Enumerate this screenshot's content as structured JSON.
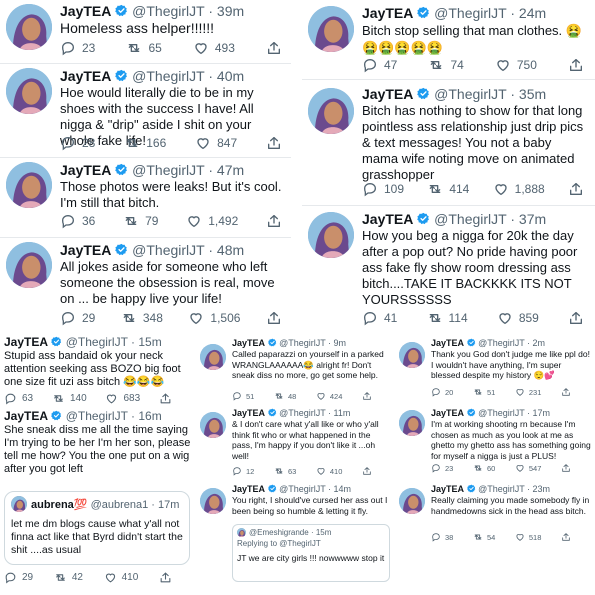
{
  "colors": {
    "text": "#0f1419",
    "secondary": "#536471",
    "verified": "#1d9bf0",
    "border": "#cfd9de"
  },
  "tweets": [
    {
      "name": "JayTEA",
      "handle": "@ThegirlJT",
      "time": "39m",
      "text": "Homeless ass helper!!!!!!",
      "replies": "23",
      "retweets": "65",
      "likes": "493"
    },
    {
      "name": "JayTEA",
      "handle": "@ThegirlJT",
      "time": "24m",
      "text": "Bitch stop selling that man clothes. 🤮\n🤮🤮🤮🤮🤮",
      "replies": "47",
      "retweets": "74",
      "likes": "750"
    },
    {
      "name": "JayTEA",
      "handle": "@ThegirlJT",
      "time": "40m",
      "text": "Hoe would literally die to be in my shoes with the success I have! All nigga & \"drip\" aside I shit on your whole fake life!",
      "replies": "28",
      "retweets": "166",
      "likes": "847"
    },
    {
      "name": "JayTEA",
      "handle": "@ThegirlJT",
      "time": "35m",
      "text": "Bitch has nothing to show for that long pointless ass relationship just drip pics & text messages! You not a baby mama wife noting move on animated grasshopper",
      "replies": "109",
      "retweets": "414",
      "likes": "1,888"
    },
    {
      "name": "JayTEA",
      "handle": "@ThegirlJT",
      "time": "47m",
      "text": "Those photos were leaks! But it's cool. I'm still that bitch.",
      "replies": "36",
      "retweets": "79",
      "likes": "1,492"
    },
    {
      "name": "JayTEA",
      "handle": "@ThegirlJT",
      "time": "37m",
      "text": "How you beg a nigga for 20k the day after a pop out? No pride having poor ass fake fly show room dressing ass bitch....TAKE IT BACKKKK ITS NOT YOURSSSSSS",
      "replies": "41",
      "retweets": "114",
      "likes": "859"
    },
    {
      "name": "JayTEA",
      "handle": "@ThegirlJT",
      "time": "48m",
      "text": "All jokes aside for someone who left someone the obsession is real, move on ... be happy live your life!",
      "replies": "29",
      "retweets": "348",
      "likes": "1,506"
    },
    {
      "name": "JayTEA",
      "handle": "@ThegirlJT",
      "time": "15m",
      "text": "Stupid ass bandaid ok your neck attention seeking ass BOZO big foot one size fit uzi ass bitch 😂😂😂",
      "replies": "63",
      "retweets": "140",
      "likes": "683"
    },
    {
      "name": "JayTEA",
      "handle": "@ThegirlJT",
      "time": "9m",
      "text": "Called paparazzi on yourself in a parked WRANGLAAAAAA😂 alright fr! Don't sneak diss no more, go get some help.",
      "replies": "51",
      "retweets": "48",
      "likes": "424"
    },
    {
      "name": "JayTEA",
      "handle": "@ThegirlJT",
      "time": "2m",
      "text": "Thank you God don't judge me like ppl do! I wouldn't have anything, I'm super blessed despite my history 😌💕",
      "replies": "20",
      "retweets": "51",
      "likes": "231"
    },
    {
      "name": "JayTEA",
      "handle": "@ThegirlJT",
      "time": "16m",
      "text": "She sneak diss me all the time saying I'm trying to be her I'm her son, please tell me how? You the one put on a wig after you got left",
      "quote": {
        "name": "aubrena💯",
        "handle": "@aubrena1",
        "time": "17m",
        "text": "let me dm blogs cause what y'all not finna act like that Byrd didn't start the shit ....as usual"
      },
      "replies": "29",
      "retweets": "42",
      "likes": "410"
    },
    {
      "name": "JayTEA",
      "handle": "@ThegirlJT",
      "time": "11m",
      "text": "& I don't care what y'all like or who y'all think fit who or what happened in the pass, I'm happy if you don't like it ...oh well!",
      "replies": "12",
      "retweets": "63",
      "likes": "410"
    },
    {
      "name": "JayTEA",
      "handle": "@ThegirlJT",
      "time": "17m",
      "text": "I'm at working shooting rn because I'm chosen as much as you look at me as ghetto my ghetto ass has something going for myself a nigga is just a PLUS!",
      "replies": "23",
      "retweets": "60",
      "likes": "547"
    },
    {
      "name": "JayTEA",
      "handle": "@ThegirlJT",
      "time": "14m",
      "text": "You right, I should've cursed her ass out I been being so humble & letting it fly.",
      "quote": {
        "name": "@Emeshigrande",
        "time": "15m",
        "reply": "Replying to @ThegirlJT",
        "text": "JT we are city girls !!! nowwwww stop it"
      },
      "replies": "",
      "retweets": "",
      "likes": ""
    },
    {
      "name": "JayTEA",
      "handle": "@ThegirlJT",
      "time": "23m",
      "text": "Really claiming you made somebody fly in handmedowns sick in the head ass bitch.",
      "replies": "38",
      "retweets": "54",
      "likes": "518"
    }
  ]
}
